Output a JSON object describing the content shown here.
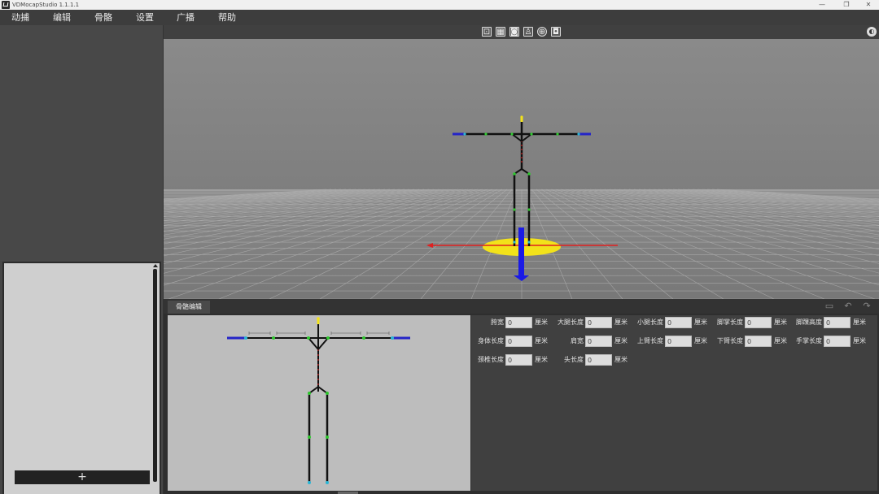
{
  "titlebar": {
    "title": "VDMocapStudio 1.1.1.1",
    "minimize": "—",
    "restore": "❐",
    "close": "✕"
  },
  "menu": {
    "items": [
      "动捕",
      "编辑",
      "骨骼",
      "设置",
      "广播",
      "帮助"
    ]
  },
  "left_panel": {
    "add_button": "+"
  },
  "toolbar": {
    "icons": [
      "fit-view-icon",
      "qr-grid-icon",
      "focus-frame-icon",
      "figure-frame-icon",
      "target-icon",
      "camera-icon"
    ],
    "right_icon": "palette-icon"
  },
  "editor": {
    "tab_label": "骨骼编辑",
    "icons": [
      "save-icon",
      "undo-icon",
      "redo-icon"
    ],
    "params": [
      {
        "label": "胯宽",
        "value": "0",
        "unit": "厘米"
      },
      {
        "label": "大腿长度",
        "value": "0",
        "unit": "厘米"
      },
      {
        "label": "小腿长度",
        "value": "0",
        "unit": "厘米"
      },
      {
        "label": "脚掌长度",
        "value": "0",
        "unit": "厘米"
      },
      {
        "label": "脚踝高度",
        "value": "0",
        "unit": "厘米"
      },
      {
        "label": "身体长度",
        "value": "0",
        "unit": "厘米"
      },
      {
        "label": "肩宽",
        "value": "0",
        "unit": "厘米"
      },
      {
        "label": "上臂长度",
        "value": "0",
        "unit": "厘米"
      },
      {
        "label": "下臂长度",
        "value": "0",
        "unit": "厘米"
      },
      {
        "label": "手掌长度",
        "value": "0",
        "unit": "厘米"
      },
      {
        "label": "颈椎长度",
        "value": "0",
        "unit": "厘米"
      },
      {
        "label": "头长度",
        "value": "0",
        "unit": "厘米"
      }
    ]
  },
  "colors": {
    "axis_x": "#e02020",
    "axis_z": "#1a1ae6",
    "ground_disc": "#f2e21a",
    "joint": "#2ec82e",
    "bone": "#111111"
  }
}
